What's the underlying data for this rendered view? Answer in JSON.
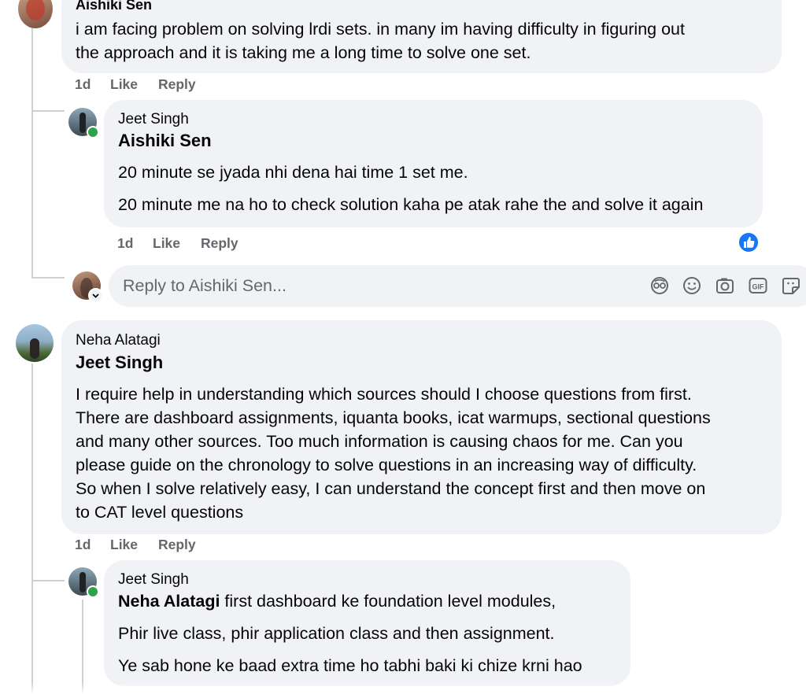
{
  "comments": [
    {
      "author": "Aishiki Sen",
      "text_lines": [
        "i am facing problem on solving lrdi sets. in many im having difficulty in figuring out",
        "the approach and it is taking me a long time to solve one set."
      ],
      "meta": {
        "time": "1d",
        "like": "Like",
        "reply": "Reply"
      },
      "reply": {
        "author": "Jeet Singh",
        "mention": "Aishiki Sen",
        "paragraphs": [
          "20 minute se jyada nhi dena hai time 1 set me.",
          "20 minute me na ho to check solution kaha pe atak rahe the and solve it again"
        ],
        "meta": {
          "time": "1d",
          "like": "Like",
          "reply": "Reply"
        },
        "reaction": "like-icon"
      },
      "reply_input": {
        "placeholder": "Reply to Aishiki Sen..."
      }
    },
    {
      "author": "Neha Alatagi",
      "mention": "Jeet Singh",
      "text_lines": [
        "I require help in understanding which sources should I choose questions from first.",
        "There are dashboard assignments, iquanta books, icat warmups, sectional questions",
        "and many other sources. Too much information is causing chaos for me. Can you",
        "please guide on the chronology to solve questions in an increasing way of difficulty.",
        "So when I solve relatively easy, I can understand the concept first and then move on",
        "to CAT level questions"
      ],
      "meta": {
        "time": "1d",
        "like": "Like",
        "reply": "Reply"
      },
      "reply": {
        "author": "Jeet Singh",
        "mention": "Neha Alatagi",
        "first_line_rest": " first dashboard ke foundation level modules,",
        "paragraphs": [
          "Phir live class, phir application class and then assignment.",
          "Ye sab hone ke baad extra time ho tabhi baki ki chize krni hao"
        ]
      }
    }
  ],
  "colors": {
    "bubble": "#f0f2f5",
    "meta": "#65676b",
    "like_blue": "#1877f2",
    "online": "#31a24c",
    "thread_line": "#ced0d4"
  }
}
